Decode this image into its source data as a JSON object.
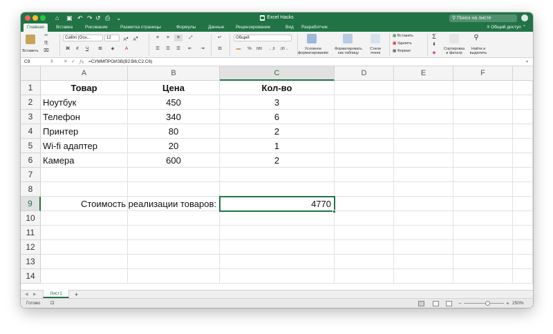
{
  "window": {
    "title": "Excel Hacks"
  },
  "search": {
    "placeholder": "Поиск на листе"
  },
  "share_label": "Общий доступ",
  "colors": {
    "accent": "#217346",
    "selection": "#217346"
  },
  "tabs": [
    {
      "label": "Главная",
      "active": true
    },
    {
      "label": "Вставка"
    },
    {
      "label": "Рисование"
    },
    {
      "label": "Разметка страницы"
    },
    {
      "label": "Формулы"
    },
    {
      "label": "Данные"
    },
    {
      "label": "Рецензирование"
    },
    {
      "label": "Вид"
    },
    {
      "label": "Разработчик"
    }
  ],
  "ribbon": {
    "paste_label": "Вставить",
    "font_name": "Calibri (Осн...",
    "font_size": "12",
    "number_format": "Общий",
    "cond_format": [
      "Условное",
      "форматирование"
    ],
    "format_table": [
      "Форматировать",
      "как таблицу"
    ],
    "cell_styles": [
      "Стили",
      "ячеек"
    ],
    "insert": "Вставить",
    "delete": "Удалить",
    "format": "Формат",
    "sort_filter": [
      "Сортировка",
      "и фильтр"
    ],
    "find_select": [
      "Найти и",
      "выделить"
    ]
  },
  "formula_bar": {
    "name_box": "C9",
    "formula": "=СУММПРОИЗВ(B2:B6;C2:C6)"
  },
  "columns": [
    "A",
    "B",
    "C",
    "D",
    "E",
    "F"
  ],
  "rows": [
    "1",
    "2",
    "3",
    "4",
    "5",
    "6",
    "7",
    "8",
    "9",
    "10",
    "11",
    "12",
    "13",
    "14"
  ],
  "table": {
    "headers": [
      "Товар",
      "Цена",
      "Кол-во"
    ],
    "rows": [
      [
        "Ноутбук",
        "450",
        "3"
      ],
      [
        "Телефон",
        "340",
        "6"
      ],
      [
        "Принтер",
        "80",
        "2"
      ],
      [
        "Wi-fi адаптер",
        "20",
        "1"
      ],
      [
        "Камера",
        "600",
        "2"
      ]
    ]
  },
  "summary": {
    "label": "Стоимость реализации товаров:",
    "value": "4770"
  },
  "sheet": {
    "tab": "Лист1"
  },
  "status": {
    "text": "Готово",
    "zoom": "250%"
  }
}
